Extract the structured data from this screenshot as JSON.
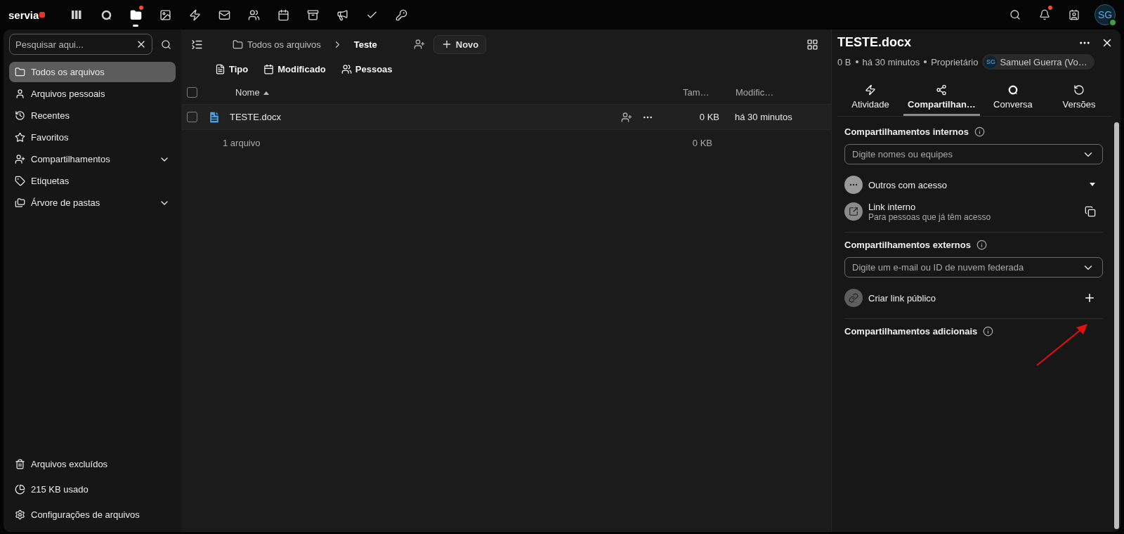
{
  "topbar": {
    "logo": "servia",
    "apps": [
      {
        "kind": "grid",
        "selected": false,
        "badge": false
      },
      {
        "kind": "talk",
        "selected": false,
        "badge": false
      },
      {
        "kind": "files",
        "selected": true,
        "badge": true
      },
      {
        "kind": "photos",
        "selected": false,
        "badge": false
      },
      {
        "kind": "activity",
        "selected": false,
        "badge": false
      },
      {
        "kind": "mail",
        "selected": false,
        "badge": false
      },
      {
        "kind": "contacts",
        "selected": false,
        "badge": false
      },
      {
        "kind": "calendar",
        "selected": false,
        "badge": false
      },
      {
        "kind": "deck",
        "selected": false,
        "badge": false
      },
      {
        "kind": "announcements",
        "selected": false,
        "badge": false
      },
      {
        "kind": "tasks",
        "selected": false,
        "badge": false
      },
      {
        "kind": "passwords",
        "selected": false,
        "badge": false
      }
    ],
    "actions": [
      {
        "kind": "search",
        "badge": false
      },
      {
        "kind": "notifications",
        "badge": true
      },
      {
        "kind": "contacts-menu",
        "badge": false
      }
    ],
    "avatar": {
      "initials": "SG",
      "online": true
    }
  },
  "sidebar": {
    "search": {
      "placeholder": "Pesquisar aqui..."
    },
    "items": [
      {
        "kind": "folder",
        "label": "Todos os arquivos",
        "selected": true
      },
      {
        "kind": "user",
        "label": "Arquivos pessoais",
        "selected": false
      },
      {
        "kind": "history",
        "label": "Recentes",
        "selected": false
      },
      {
        "kind": "star",
        "label": "Favoritos",
        "selected": false
      },
      {
        "kind": "share",
        "label": "Compartilhamentos",
        "selected": false,
        "expanded": false
      },
      {
        "kind": "tag",
        "label": "Etiquetas",
        "selected": false
      },
      {
        "kind": "folders",
        "label": "Árvore de pastas",
        "selected": false,
        "expanded": false
      }
    ],
    "footer": [
      {
        "kind": "trash",
        "label": "Arquivos excluídos"
      },
      {
        "kind": "quota",
        "label": "215 KB usado"
      },
      {
        "kind": "settings",
        "label": "Configurações de arquivos"
      }
    ]
  },
  "files": {
    "breadcrumbs": [
      "Todos os arquivos",
      "Teste"
    ],
    "new_button": "Novo",
    "filters": [
      {
        "kind": "type",
        "label": "Tipo"
      },
      {
        "kind": "modified",
        "label": "Modificado"
      },
      {
        "kind": "people",
        "label": "Pessoas"
      }
    ],
    "select_all": {
      "checked": false
    },
    "columns": [
      {
        "label": "Nome",
        "sorted": true
      },
      {
        "label": "Tam…"
      },
      {
        "label": "Modific…"
      }
    ],
    "rows": [
      {
        "name": "TESTE.docx",
        "size": "0 KB",
        "modified": "há 30 minutos",
        "checked": false
      }
    ],
    "summary": {
      "count": "1 arquivo",
      "size": "0 KB"
    }
  },
  "panel": {
    "title": "TESTE.docx",
    "size": "0 B",
    "modified": "há 30 minutos",
    "owner_label": "Proprietário",
    "owner": {
      "initials": "SG",
      "name": "Samuel Guerra (Vo…"
    },
    "tabs": [
      {
        "kind": "activity",
        "label": "Atividade",
        "selected": false
      },
      {
        "kind": "sharing",
        "label": "Compartilhan…",
        "selected": true
      },
      {
        "kind": "talk",
        "label": "Conversa",
        "selected": false
      },
      {
        "kind": "versions",
        "label": "Versões",
        "selected": false
      }
    ],
    "sections": [
      {
        "title": "Compartilhamentos internos",
        "placeholder": "Digite nomes ou equipes",
        "entries": [
          {
            "kind": "others",
            "title": "Outros com acesso"
          },
          {
            "kind": "internal-link",
            "title": "Link interno",
            "subtitle": "Para pessoas que já têm acesso"
          }
        ]
      },
      {
        "title": "Compartilhamentos externos",
        "placeholder": "Digite um e-mail ou ID de nuvem federada",
        "entries": [
          {
            "kind": "public-link",
            "title": "Criar link público"
          }
        ]
      },
      {
        "title": "Compartilhamentos adicionais"
      }
    ]
  }
}
